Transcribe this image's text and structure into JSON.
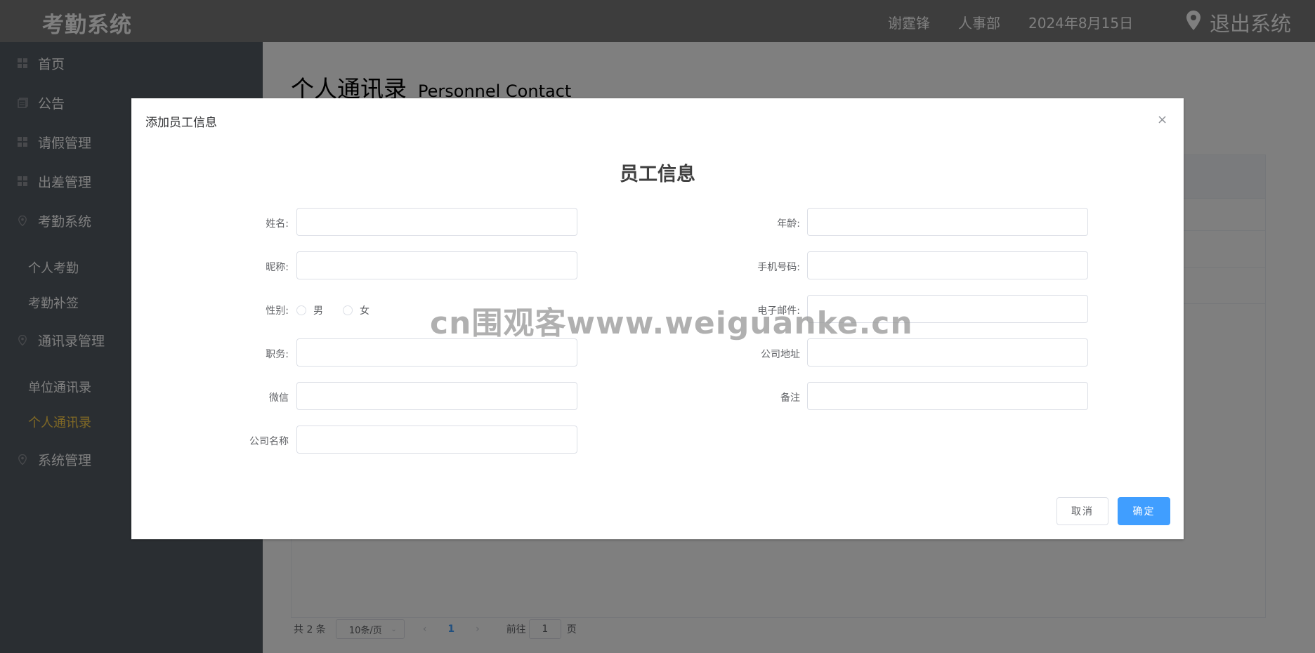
{
  "header": {
    "app_title": "考勤系统",
    "user_name": "谢霆锋",
    "department": "人事部",
    "date": "2024年8月15日",
    "logout_label": "退出系统",
    "logout_icon": "location-pin-icon"
  },
  "sidebar": {
    "items": [
      {
        "label": "首页",
        "icon": "grid-icon"
      },
      {
        "label": "公告",
        "icon": "document-icon"
      },
      {
        "label": "请假管理",
        "icon": "grid-icon"
      },
      {
        "label": "出差管理",
        "icon": "grid-icon"
      },
      {
        "label": "考勤系统",
        "icon": "location-icon"
      },
      {
        "label": "通讯录管理",
        "icon": "location-icon"
      },
      {
        "label": "系统管理",
        "icon": "location-icon"
      }
    ],
    "subitems": [
      {
        "label": "个人考勤"
      },
      {
        "label": "考勤补签"
      },
      {
        "label": "单位通讯录"
      },
      {
        "label": "个人通讯录",
        "active": true
      }
    ]
  },
  "main": {
    "title_cn": "个人通讯录",
    "title_en": "Personnel Contact"
  },
  "pagination": {
    "total": "共 2 条",
    "page_size": "10条/页",
    "prev_icon": "chevron-left-icon",
    "current_page": "1",
    "next_icon": "chevron-right-icon",
    "goto_label": "前往",
    "goto_value": "1",
    "page_unit": "页"
  },
  "dialog": {
    "title": "添加员工信息",
    "close": "×",
    "heading": "员工信息",
    "labels": {
      "name": "姓名:",
      "age": "年龄:",
      "nickname": "昵称:",
      "phone": "手机号码:",
      "gender": "性别:",
      "email": "电子邮件:",
      "position": "职务:",
      "address": "公司地址",
      "wechat": "微信",
      "remark": "备注",
      "company": "公司名称"
    },
    "gender_options": [
      "男",
      "女"
    ],
    "cancel_label": "取消",
    "confirm_label": "确定"
  },
  "watermark": "cn围观客www.weiguanke.cn",
  "colors": {
    "header_bg": "#7a7a7a",
    "sidebar_bg": "#545c64",
    "active_menu": "#ffd04b",
    "primary": "#409eff"
  }
}
